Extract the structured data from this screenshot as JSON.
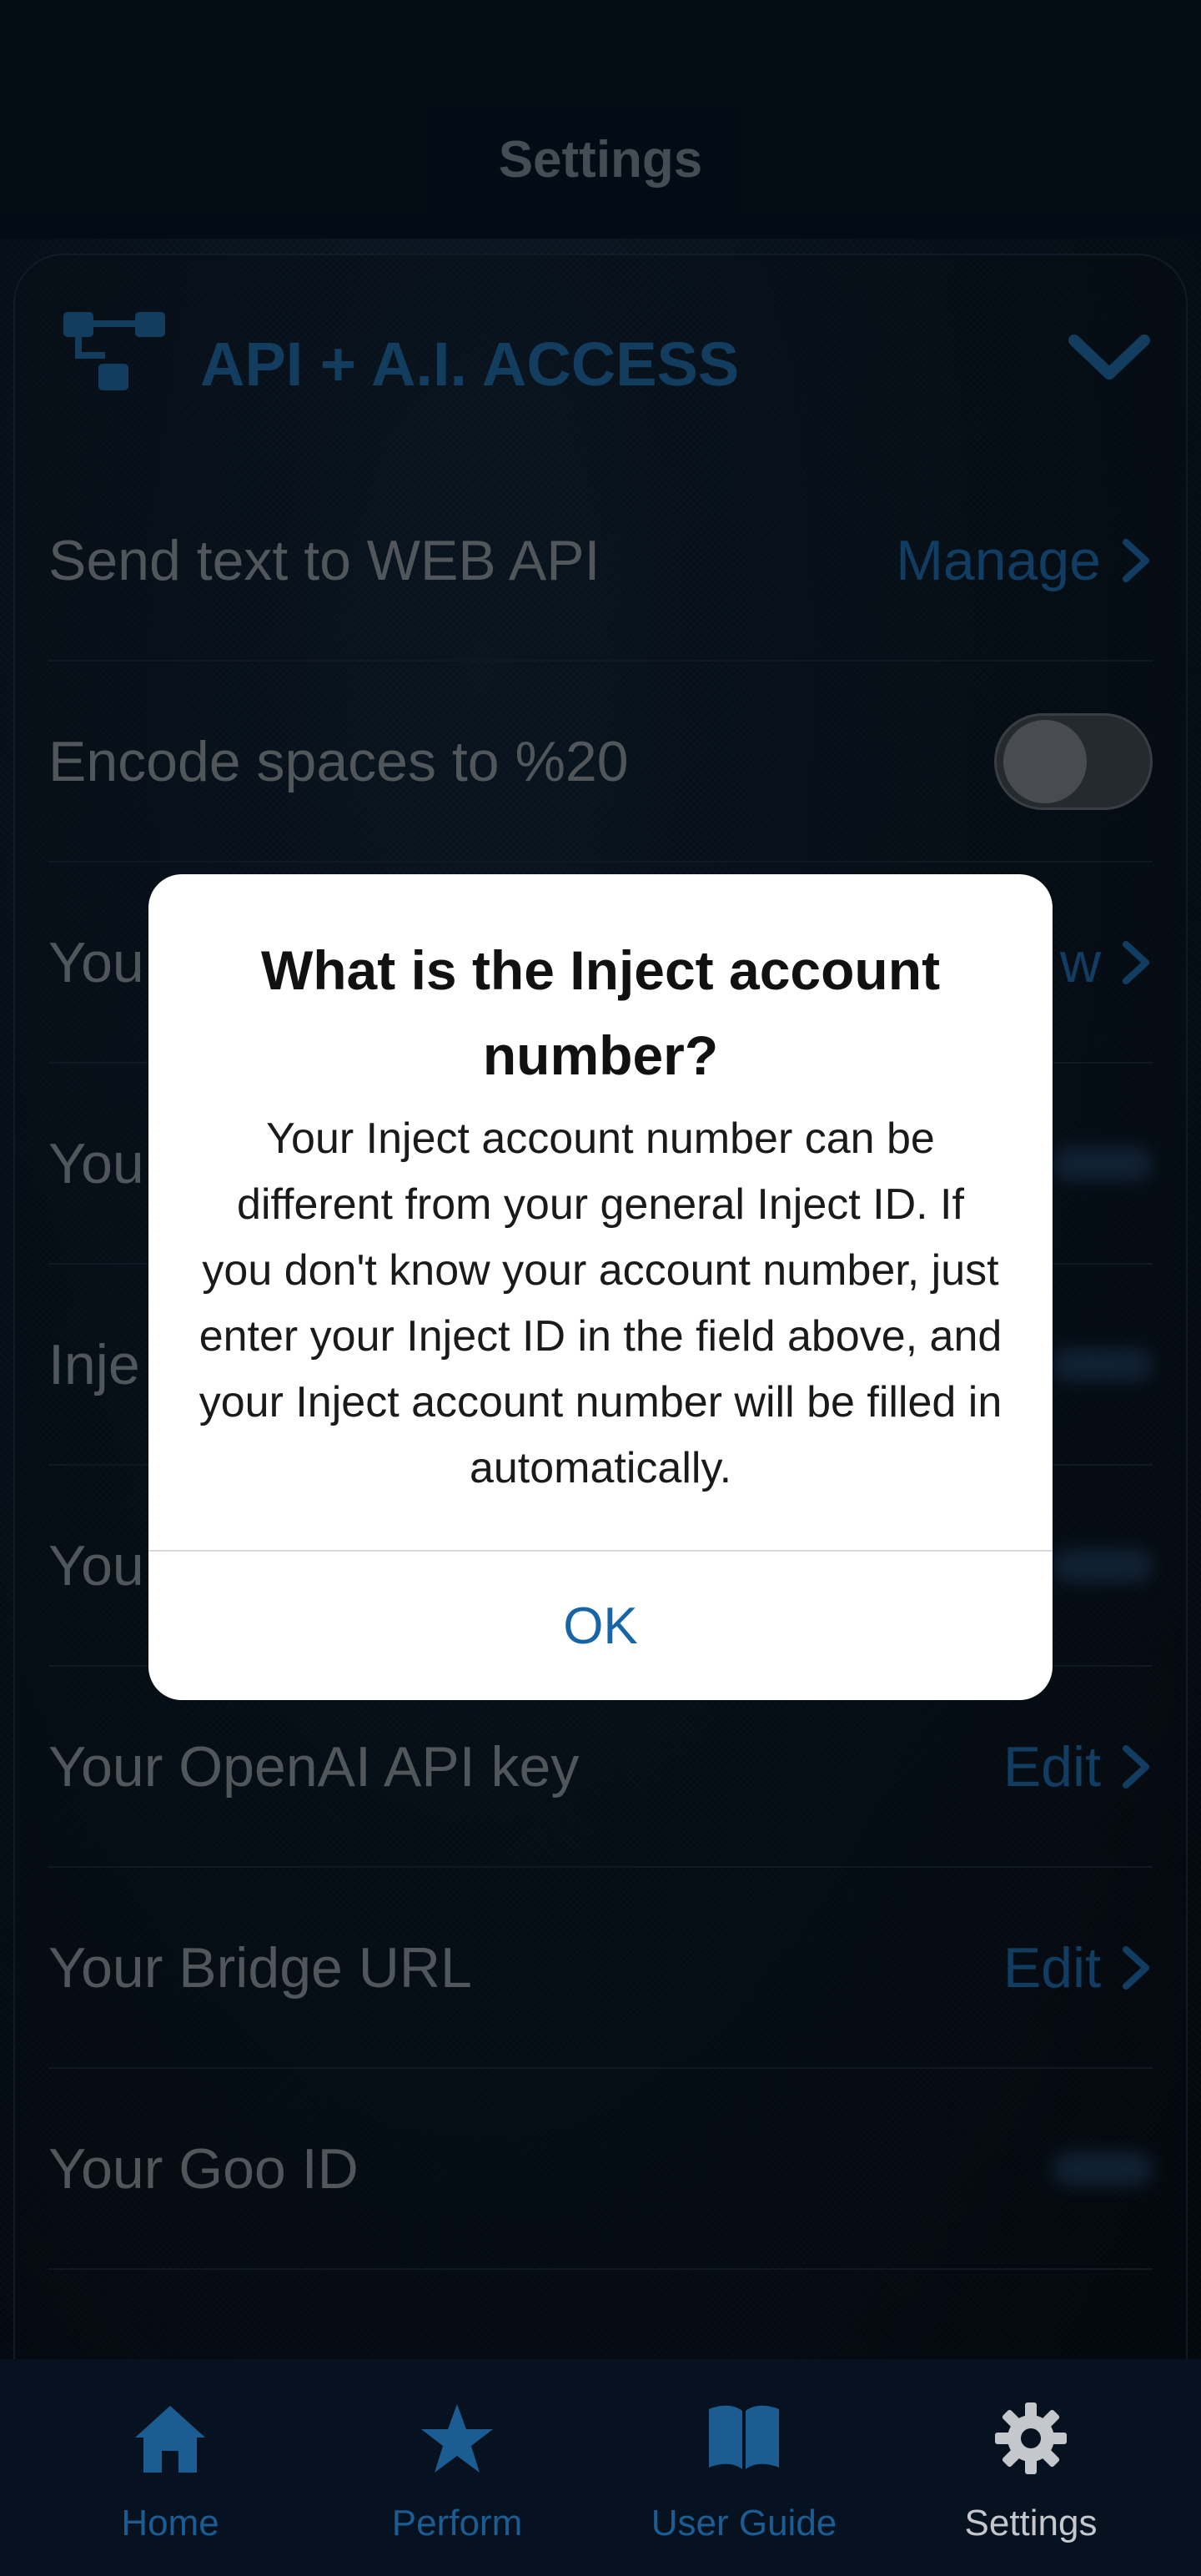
{
  "header": {
    "title": "Settings"
  },
  "section": {
    "title": "API + A.I. ACCESS",
    "icon": "sitemap-icon",
    "accent": "#1e5f93"
  },
  "rows": [
    {
      "label": "Send text to WEB API",
      "action": "Manage"
    },
    {
      "label": "Encode spaces to %20",
      "toggle": false
    },
    {
      "label": "You",
      "action": "w"
    },
    {
      "label": "You"
    },
    {
      "label": "Inje"
    },
    {
      "label": "You"
    },
    {
      "label": "Your OpenAI API key",
      "action": "Edit"
    },
    {
      "label": "Your Bridge URL",
      "action": "Edit"
    },
    {
      "label": "Your Goo ID"
    }
  ],
  "dialog": {
    "title": "What is the Inject account number?",
    "body": "Your Inject account number can be different from your general Inject ID. If you don't know your account number, just enter your Inject ID in the field above, and your Inject account number will be filled in automatically.",
    "ok_label": "OK"
  },
  "nav": [
    {
      "label": "Home",
      "icon": "home-icon"
    },
    {
      "label": "Perform",
      "icon": "star-icon"
    },
    {
      "label": "User Guide",
      "icon": "book-icon"
    },
    {
      "label": "Settings",
      "icon": "gear-icon",
      "active": true
    }
  ]
}
